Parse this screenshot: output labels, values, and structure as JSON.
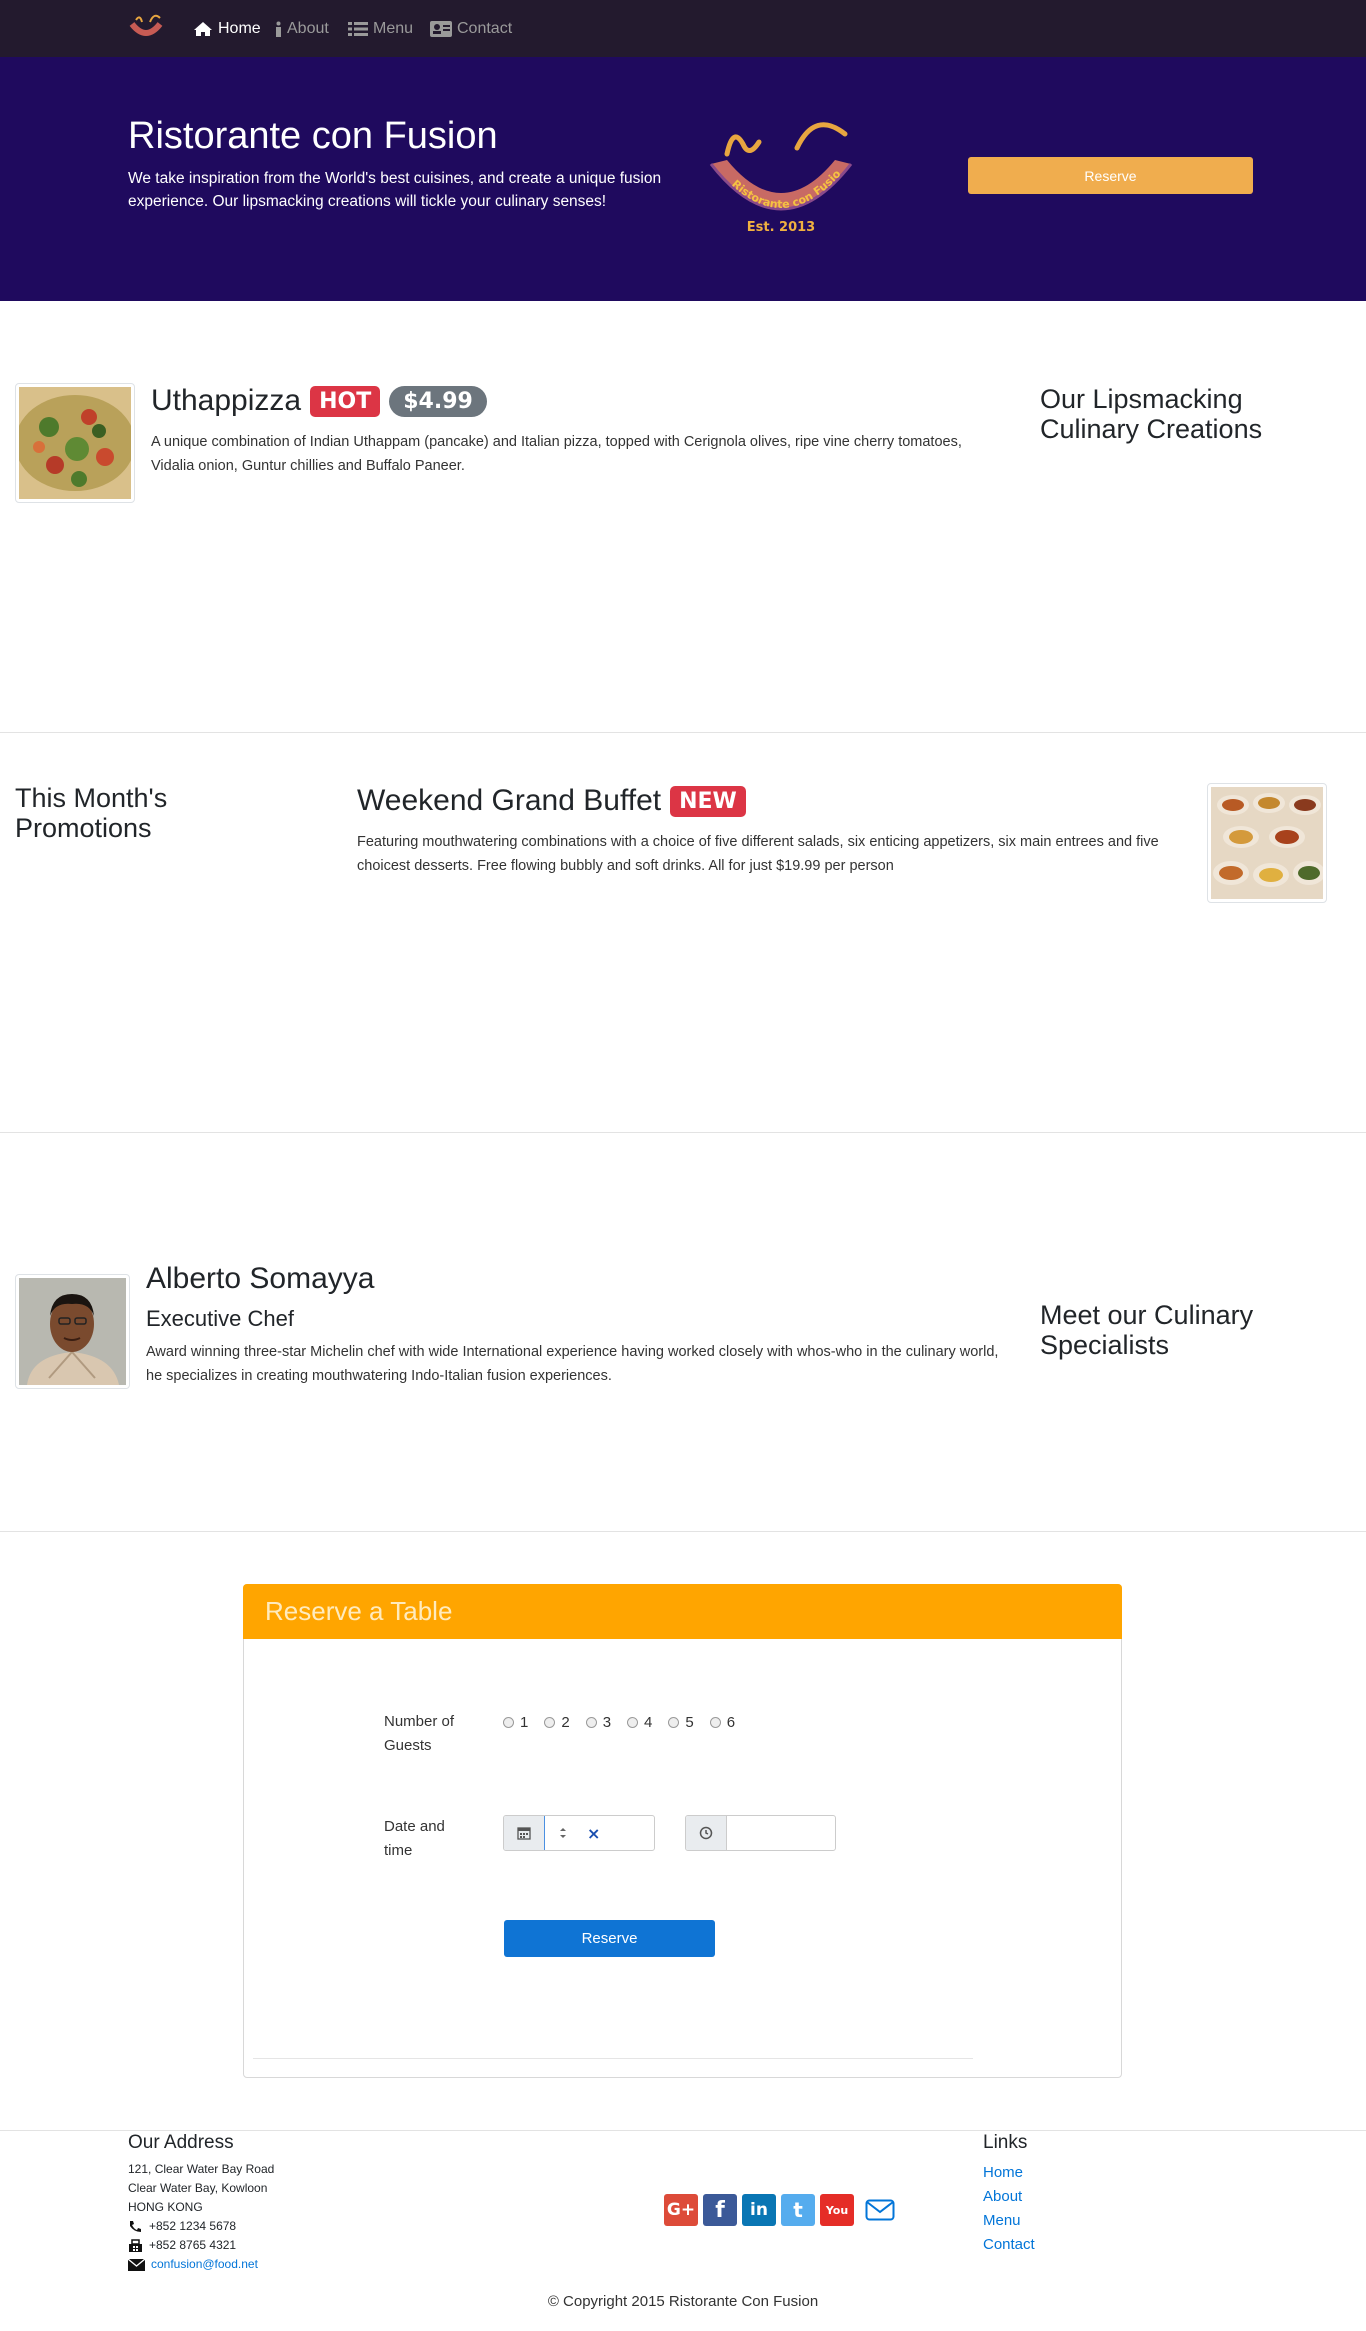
{
  "navbar": {
    "items": [
      {
        "label": "Home",
        "icon": "home-icon"
      },
      {
        "label": "About",
        "icon": "info-icon"
      },
      {
        "label": "Menu",
        "icon": "list-icon"
      },
      {
        "label": "Contact",
        "icon": "address-card-icon"
      }
    ]
  },
  "jumbotron": {
    "title": "Ristorante con Fusion",
    "description": "We take inspiration from the World's best cuisines, and create a unique fusion experience. Our lipsmacking creations will tickle your culinary senses!",
    "logo_text": "Ristorante con Fusion",
    "logo_est": "Est. 2013",
    "reserve_label": "Reserve"
  },
  "dish": {
    "name": "Uthappizza",
    "badge": "HOT",
    "price": "$4.99",
    "description": "A unique combination of Indian Uthappam (pancake) and Italian pizza, topped with Cerignola olives, ripe vine cherry tomatoes, Vidalia onion, Guntur chillies and Buffalo Paneer.",
    "section_heading": "Our Lipsmacking Culinary Creations"
  },
  "promotion": {
    "section_heading": "This Month's Promotions",
    "name": "Weekend Grand Buffet",
    "badge": "NEW",
    "description": "Featuring mouthwatering combinations with a choice of five different salads, six enticing appetizers, six main entrees and five choicest desserts. Free flowing bubbly and soft drinks. All for just $19.99 per person"
  },
  "leader": {
    "name": "Alberto Somayya",
    "designation": "Executive Chef",
    "description": "Award winning three-star Michelin chef with wide International experience having worked closely with whos-who in the culinary world, he specializes in creating mouthwatering Indo-Italian fusion experiences.",
    "section_heading": "Meet our Culinary Specialists"
  },
  "reserve_form": {
    "title": "Reserve a Table",
    "guests_label": "Number of Guests",
    "guest_options": [
      "1",
      "2",
      "3",
      "4",
      "5",
      "6"
    ],
    "datetime_label": "Date and time",
    "date_clear": "×",
    "submit_label": "Reserve"
  },
  "footer": {
    "address_heading": "Our Address",
    "address_lines": [
      "121, Clear Water Bay Road",
      "Clear Water Bay, Kowloon",
      "HONG KONG"
    ],
    "phone": "+852 1234 5678",
    "fax": "+852 8765 4321",
    "email": "confusion@food.net",
    "links_heading": "Links",
    "links": [
      "Home",
      "About",
      "Menu",
      "Contact"
    ],
    "social": [
      {
        "icon": "google-plus-icon",
        "text": "G+",
        "color": "#dd4b39"
      },
      {
        "icon": "facebook-icon",
        "text": "f",
        "color": "#3b5998"
      },
      {
        "icon": "linkedin-icon",
        "text": "in",
        "color": "#0976b4"
      },
      {
        "icon": "twitter-icon",
        "text": "t",
        "color": "#55acee"
      },
      {
        "icon": "youtube-icon",
        "text": "You",
        "color": "#e52d27"
      }
    ],
    "copyright": "© Copyright 2015 Ristorante Con Fusion"
  },
  "colors": {
    "navbar": "#231a2e",
    "jumbotron": "#1f0a5e",
    "reserve_button": "#f0ad4e",
    "card_header": "#ffa500",
    "primary": "#0f74d4",
    "danger": "#dc3545"
  }
}
